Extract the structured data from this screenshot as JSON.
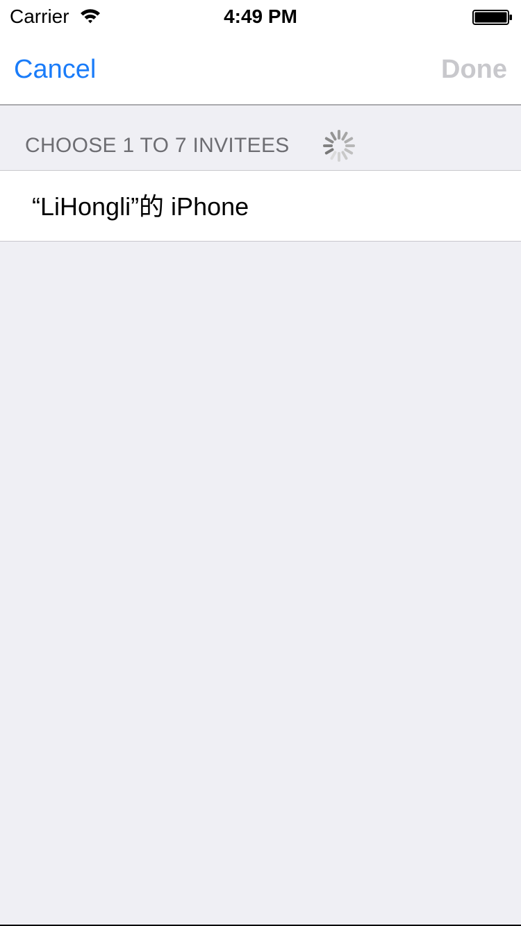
{
  "status_bar": {
    "carrier": "Carrier",
    "time": "4:49 PM",
    "wifi_icon": "wifi-icon",
    "battery_icon": "battery-full-icon"
  },
  "nav": {
    "cancel_label": "Cancel",
    "done_label": "Done"
  },
  "section": {
    "title": "CHOOSE 1 TO 7 INVITEES",
    "loading_icon": "activity-spinner-icon"
  },
  "invitees": [
    {
      "name": "“LiHongli”的 iPhone"
    }
  ],
  "colors": {
    "accent": "#1a7cf9",
    "disabled": "#c8c8cc",
    "background": "#efeff4",
    "section_text": "#6d6d72"
  }
}
